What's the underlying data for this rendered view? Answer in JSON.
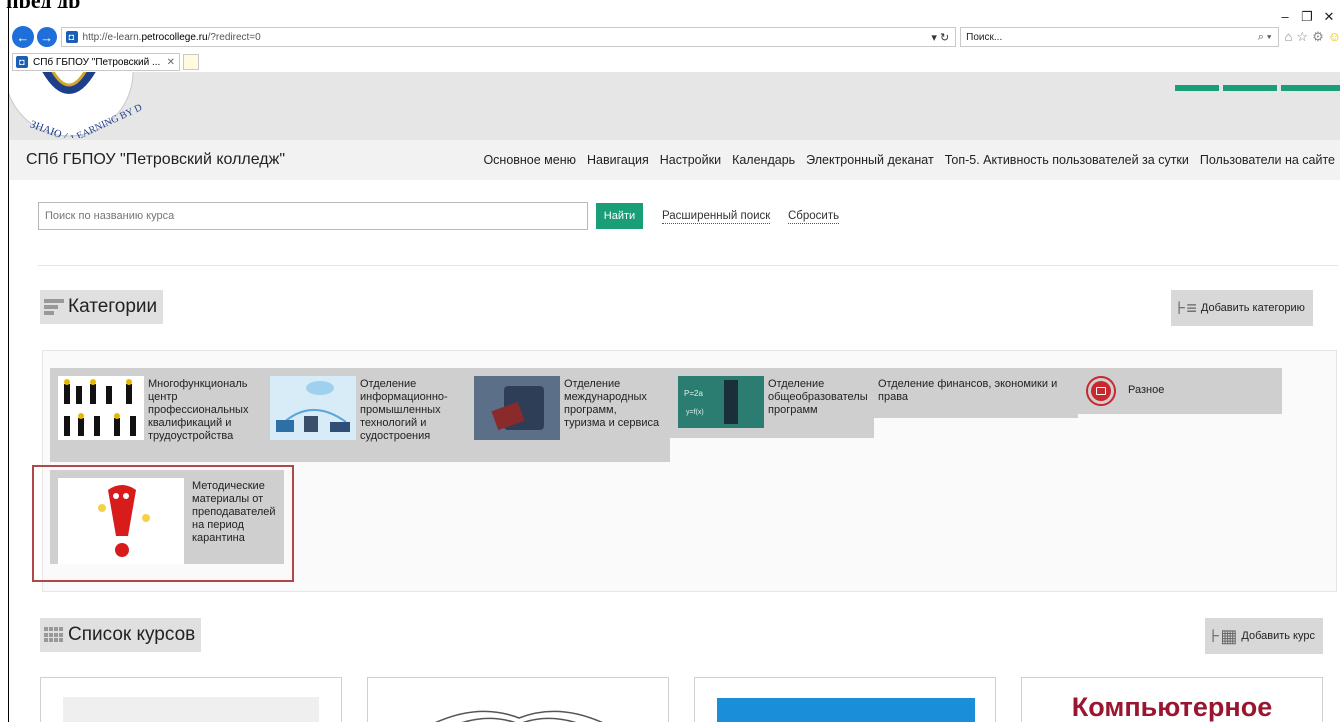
{
  "doc_heading": "пред др",
  "window": {
    "controls": [
      "–",
      "❐",
      "✕"
    ]
  },
  "browser": {
    "back_glyph": "←",
    "forward_glyph": "→",
    "url_prefix": "http://e-learn.",
    "url_host": "petrocollege.ru",
    "url_path": "/?redirect=0",
    "addr_tools": "▾ ↻",
    "search_placeholder": "Поиск...",
    "search_icons": "⌕ ▾",
    "tab_title": "СПб ГБПОУ \"Петровский ...",
    "tab_close": "✕",
    "toolbar_icons": [
      "⌂",
      "☆",
      "⚙",
      "☺"
    ]
  },
  "logo": {
    "text_left": "ЗНАЮ /",
    "text_right": "LEARNING BY D"
  },
  "header": {
    "site_name": "СПб ГБПОУ \"Петровский колледж\"",
    "menu": [
      "Основное меню",
      "Навигация",
      "Настройки",
      "Календарь",
      "Электронный деканат",
      "Топ-5. Активность пользователей за сутки",
      "Пользователи на сайте"
    ]
  },
  "search": {
    "placeholder": "Поиск по названию курса",
    "button": "Найти",
    "advanced": "Расширенный поиск",
    "reset": "Сбросить"
  },
  "categories_section": {
    "title": "Категории",
    "add_button": "Добавить категорию",
    "items": [
      {
        "label": "Многофункциональ центр профессиональных квалификаций и трудоустройства"
      },
      {
        "label": "Отделение информационно-промышленных технологий и судостроения"
      },
      {
        "label": "Отделение международных программ, туризма и сервиса"
      },
      {
        "label": "Отделение общеобразователы программ"
      },
      {
        "label": "Отделение финансов, экономики и права"
      },
      {
        "label": "Разное"
      },
      {
        "label": "Методические материалы от преподавателей на период карантина"
      }
    ]
  },
  "courses_section": {
    "title": "Список курсов",
    "add_button": "Добавить курс",
    "card4_text": "Компьютерное"
  },
  "colors": {
    "accent_green": "#1a9e77",
    "highlight_red": "#b04848",
    "browser_blue": "#1e6fd9"
  }
}
